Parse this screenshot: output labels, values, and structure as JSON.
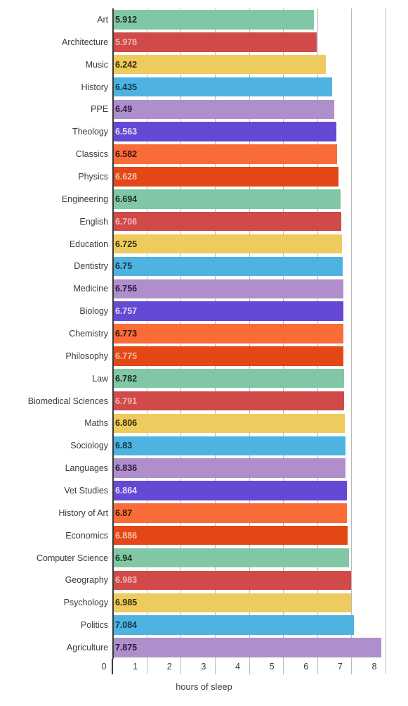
{
  "chart_data": {
    "type": "bar",
    "orientation": "horizontal",
    "title": "",
    "xlabel": "hours of sleep",
    "ylabel": "",
    "xlim": [
      0,
      8
    ],
    "xticks": [
      "0",
      "1",
      "2",
      "3",
      "4",
      "5",
      "6",
      "7",
      "8"
    ],
    "grid": true,
    "legend": false,
    "categories": [
      "Art",
      "Architecture",
      "Music",
      "History",
      "PPE",
      "Theology",
      "Classics",
      "Physics",
      "Engineering",
      "English",
      "Education",
      "Dentistry",
      "Medicine",
      "Biology",
      "Chemistry",
      "Philosophy",
      "Law",
      "Biomedical Sciences",
      "Maths",
      "Sociology",
      "Languages",
      "Vet Studies",
      "History of Art",
      "Economics",
      "Computer Science",
      "Geography",
      "Psychology",
      "Politics",
      "Agriculture"
    ],
    "values": [
      5.912,
      5.978,
      6.242,
      6.435,
      6.49,
      6.563,
      6.582,
      6.628,
      6.694,
      6.706,
      6.725,
      6.75,
      6.756,
      6.757,
      6.773,
      6.775,
      6.782,
      6.791,
      6.806,
      6.83,
      6.836,
      6.864,
      6.87,
      6.886,
      6.94,
      6.983,
      6.985,
      7.084,
      7.875
    ],
    "value_labels": [
      "5.912",
      "5.978",
      "6.242",
      "6.435",
      "6.49",
      "6.563",
      "6.582",
      "6.628",
      "6.694",
      "6.706",
      "6.725",
      "6.75",
      "6.756",
      "6.757",
      "6.773",
      "6.775",
      "6.782",
      "6.791",
      "6.806",
      "6.83",
      "6.836",
      "6.864",
      "6.87",
      "6.886",
      "6.94",
      "6.983",
      "6.985",
      "7.084",
      "7.875"
    ],
    "palette": [
      "#82c7a5",
      "#d04a4a",
      "#edcb5e",
      "#4eb3e0",
      "#ae8fcb",
      "#6549d5",
      "#f96c38",
      "#e24715"
    ],
    "label_text_palette": [
      "#14301f",
      "#f3b5b5",
      "#3a2c08",
      "#10364b",
      "#2c1840",
      "#e2dcf7",
      "#3b1304",
      "#f6c0a6"
    ],
    "axis_color": "#3a3a3a",
    "gridline_color": "#b9b9b9",
    "background": "#ffffff"
  }
}
